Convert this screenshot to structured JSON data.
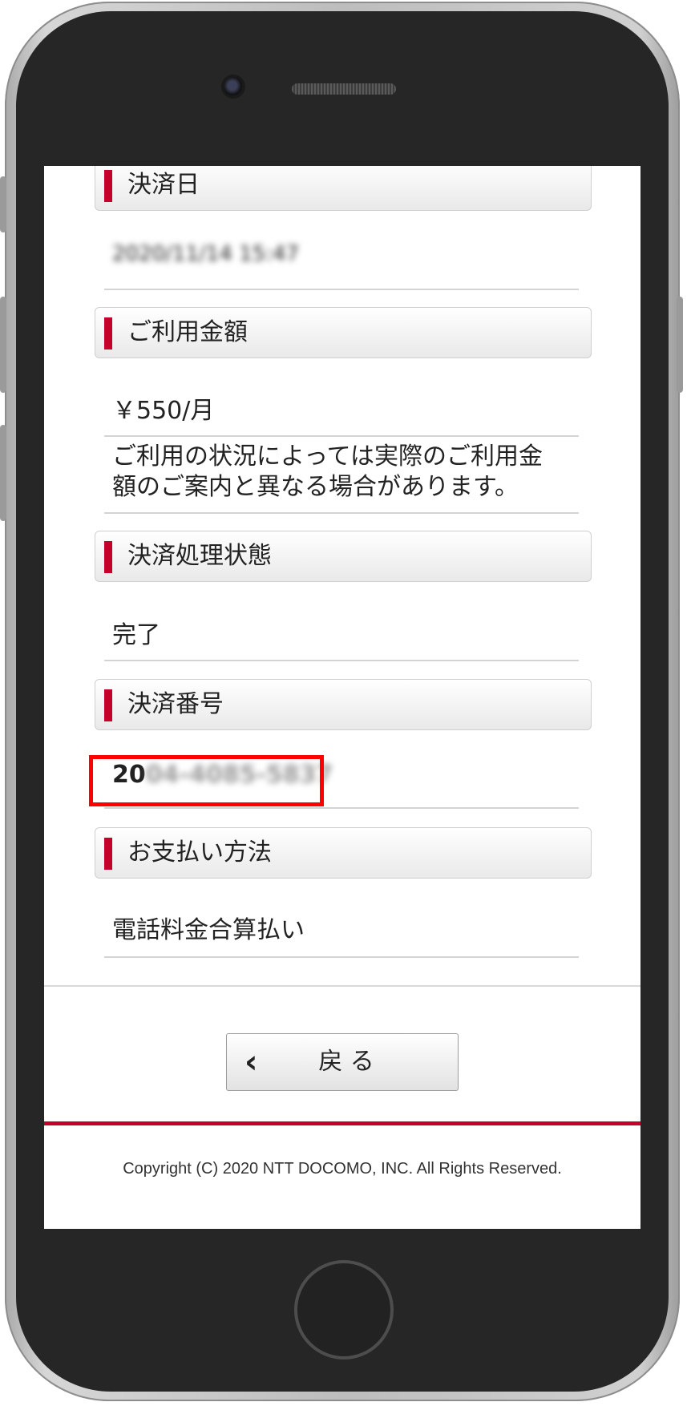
{
  "sections": [
    {
      "title": "決済日",
      "values": [
        "2020/11/14 15:47"
      ]
    },
    {
      "title": "ご利用金額",
      "values": [
        "￥550/月",
        "ご利用の状況によっては実際のご利用金",
        "額のご案内と異なる場合があります。"
      ]
    },
    {
      "title": "決済処理状態",
      "values": [
        "完了"
      ]
    },
    {
      "title": "決済番号",
      "values": [
        "2004-4085-5837"
      ]
    },
    {
      "title": "お支払い方法",
      "values": [
        "電話料金合算払い"
      ]
    }
  ],
  "payment_number_visible_prefix": "20",
  "payment_number_blurred_part": "04-4085-5837",
  "back_button": {
    "label": "戻 る",
    "icon": "chevron-left-icon"
  },
  "footer": {
    "copyright": "Copyright (C) 2020 NTT DOCOMO, INC. All Rights Reserved."
  },
  "colors": {
    "accent": "#c4002b",
    "highlight": "#ff0000"
  }
}
